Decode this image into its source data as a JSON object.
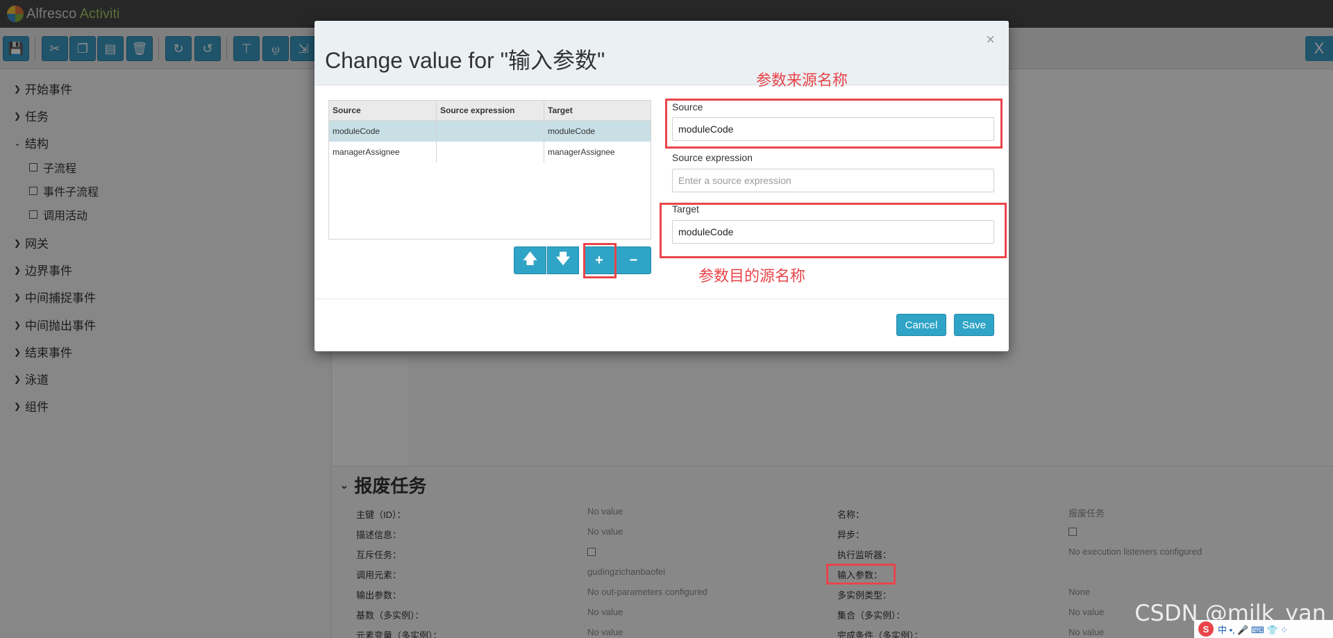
{
  "app": {
    "logo_text_1": "Alfresco",
    "logo_text_2": " Activiti"
  },
  "toolbar": {
    "icons": [
      "save-icon",
      "cut-icon",
      "copy-icon",
      "paste-icon",
      "delete-icon",
      "redo-icon",
      "undo-icon",
      "align-vertical-icon",
      "align-horizontal-icon",
      "resize-icon"
    ],
    "right_label": "X"
  },
  "palette": {
    "items": [
      {
        "label": "开始事件"
      },
      {
        "label": "任务"
      },
      {
        "label": "结构"
      },
      {
        "label": "网关"
      },
      {
        "label": "边界事件"
      },
      {
        "label": "中间捕捉事件"
      },
      {
        "label": "中间抛出事件"
      },
      {
        "label": "结束事件"
      },
      {
        "label": "泳道"
      },
      {
        "label": "组件"
      }
    ],
    "sub_items": [
      {
        "label": "子流程"
      },
      {
        "label": "事件子流程"
      },
      {
        "label": "调用活动"
      }
    ]
  },
  "properties": {
    "title": "报废任务",
    "rows": [
      {
        "label": "主键（ID）：",
        "value": "No value"
      },
      {
        "label": "名称：",
        "value": "报废任务"
      },
      {
        "label": "描述信息：",
        "value": "No value"
      },
      {
        "label": "异步：",
        "value": ""
      },
      {
        "label": "互斥任务：",
        "value": ""
      },
      {
        "label": "执行监听器：",
        "value": "No execution listeners configured"
      },
      {
        "label": "调用元素：",
        "value": "gudingzichanbaofei"
      },
      {
        "label": "输入参数：",
        "value": ""
      },
      {
        "label": "输出参数：",
        "value": "No out-parameters configured"
      },
      {
        "label": "多实例类型：",
        "value": "None"
      },
      {
        "label": "基数（多实例）：",
        "value": "No value"
      },
      {
        "label": "集合（多实例）：",
        "value": "No value"
      },
      {
        "label": "元素变量（多实例）：",
        "value": "No value"
      },
      {
        "label": "完成条件（多实例）：",
        "value": "No value"
      }
    ]
  },
  "modal": {
    "title": "Change value for \"输入参数\"",
    "close": "×",
    "grid": {
      "headers": [
        "Source",
        "Source expression",
        "Target"
      ],
      "rows": [
        {
          "source": "moduleCode",
          "expression": "",
          "target": "moduleCode",
          "selected": true
        },
        {
          "source": "managerAssignee",
          "expression": "",
          "target": "managerAssignee",
          "selected": false
        }
      ]
    },
    "controls": {
      "up": "🡅",
      "down": "🡇",
      "add": "+",
      "remove": "−"
    },
    "source_label": "Source",
    "source_value": "moduleCode",
    "expression_label": "Source expression",
    "expression_placeholder": "Enter a source expression",
    "target_label": "Target",
    "target_value": "moduleCode",
    "cancel": "Cancel",
    "save": "Save"
  },
  "annotations": {
    "source_note": "参数来源名称",
    "target_note": "参数目的源名称"
  },
  "watermark": "CSDN @milk_yan",
  "tray": {
    "ime": "S",
    "items": "中 •, 🎤 ⌨ 👕 ⁘"
  },
  "colors": {
    "accent": "#2fa4c6",
    "annotation": "#e8454a",
    "header_bg": "#ebf0f3"
  }
}
